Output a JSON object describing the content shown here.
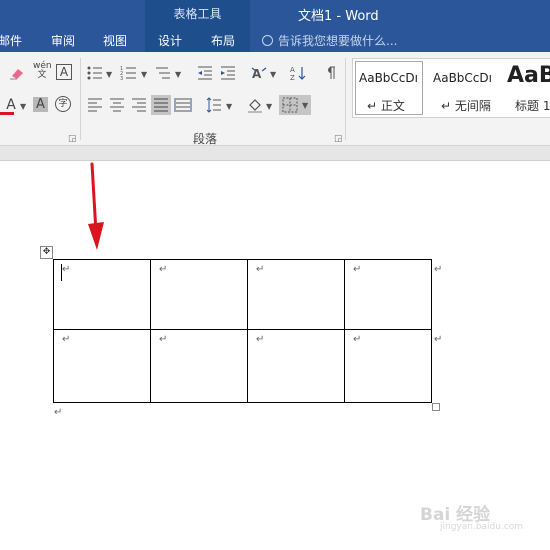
{
  "titlebar": {
    "context_tab_group": "表格工具",
    "document_title": "文档1 - Word"
  },
  "tabs": {
    "mailings": "邮件",
    "review": "审阅",
    "view": "视图",
    "design": "设计",
    "layout": "布局"
  },
  "tell_me": {
    "placeholder": "告诉我您想要做什么..."
  },
  "ribbon": {
    "paragraph_group_label": "段落",
    "font_icons": {
      "phonetic_guide": "wén\n文",
      "character_border": "A",
      "font_color": "A",
      "char_shading": "A",
      "enclose_characters": "字"
    },
    "styles": [
      {
        "sample": "AaBbCcDı",
        "name": "↵ 正文"
      },
      {
        "sample": "AaBbCcDı",
        "name": "↵ 无间隔"
      },
      {
        "sample": "AaB",
        "name": "标题 1"
      }
    ]
  },
  "document": {
    "cell_mark": "↵",
    "paragraph_mark": "↵",
    "table_move_glyph": "✥"
  },
  "watermark": {
    "brand": "Bai 经验",
    "url": "jingyan.baidu.com"
  },
  "colors": {
    "ribbon_blue": "#2b579a",
    "context_blue": "#1e4e8c",
    "arrow_red": "#d9161e"
  }
}
